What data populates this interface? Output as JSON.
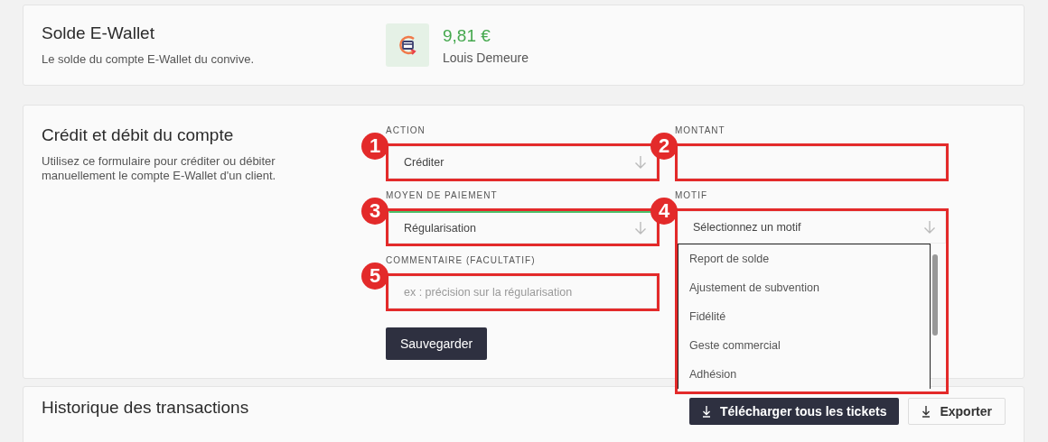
{
  "wallet": {
    "title": "Solde E-Wallet",
    "description": "Le solde du compte E-Wallet du convive.",
    "balance": "9,81 €",
    "owner": "Louis Demeure"
  },
  "account_form": {
    "title": "Crédit et débit du compte",
    "description": "Utilisez ce formulaire pour créditer ou débiter manuellement le compte E-Wallet d'un client.",
    "rows": [
      {
        "fields": [
          {
            "kind": "select",
            "label": "ACTION",
            "value": "Créditer",
            "annotation": "1"
          },
          {
            "kind": "text",
            "label": "MONTANT",
            "annotation": "2"
          }
        ]
      },
      {
        "fields": [
          {
            "kind": "select",
            "label": "MOYEN DE PAIEMENT",
            "value": "Régularisation",
            "annotation": "3",
            "focused": true
          },
          {
            "kind": "select",
            "label": "MOTIF",
            "placeholder": "Sélectionnez un motif",
            "annotation": "4",
            "expanded": true,
            "options": [
              "Report de solde",
              "Ajustement de subvention",
              "Fidélité",
              "Geste commercial",
              "Adhésion"
            ]
          }
        ]
      },
      {
        "fields": [
          {
            "kind": "text",
            "label": "COMMENTAIRE (FACULTATIF)",
            "placeholder": "ex : précision sur la régularisation",
            "annotation": "5"
          }
        ]
      }
    ],
    "save_button": "Sauvegarder"
  },
  "history": {
    "title": "Historique des transactions",
    "buttons": [
      {
        "label": "Télécharger tous les tickets",
        "kind": "primary"
      },
      {
        "label": "Exporter",
        "kind": "secondary"
      }
    ]
  }
}
